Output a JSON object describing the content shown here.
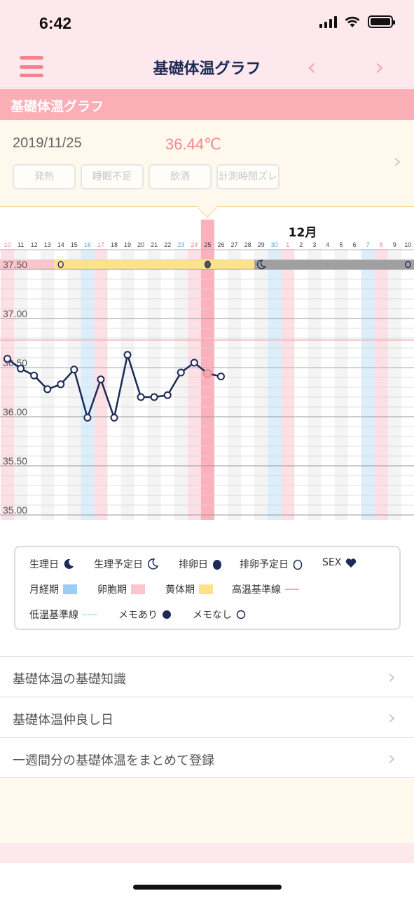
{
  "status_bar": {
    "time": "6:42"
  },
  "nav": {
    "title": "基礎体温グラフ",
    "prev": "‹",
    "next": "›"
  },
  "section": {
    "title": "基礎体温グラフ"
  },
  "day": {
    "date": "2019/11/25",
    "temperature": "36.44℃",
    "tags": [
      "発熱",
      "睡眠不足",
      "飲酒",
      "計測時間ズレ"
    ]
  },
  "chart_data": {
    "type": "line",
    "month_label": "12月",
    "x": [
      "10",
      "11",
      "12",
      "13",
      "14",
      "15",
      "16",
      "17",
      "18",
      "19",
      "20",
      "21",
      "22",
      "23",
      "24",
      "25",
      "26",
      "27",
      "28",
      "29",
      "30",
      "1",
      "2",
      "3",
      "4",
      "5",
      "6",
      "7",
      "8",
      "9",
      "10"
    ],
    "x_colors": {
      "saturday": [
        "16",
        "23",
        "30",
        "7"
      ],
      "sunday": [
        "10",
        "17",
        "24",
        "1",
        "8"
      ]
    },
    "ylim": [
      34.95,
      37.65
    ],
    "y_ticks": [
      35.0,
      35.5,
      36.0,
      36.5,
      37.0,
      37.5
    ],
    "y_tick_labels": [
      "35.00",
      "35.50",
      "36.00",
      "36.50",
      "37.00",
      "37.50"
    ],
    "series": [
      {
        "values": [
          36.59,
          36.49,
          36.42,
          36.28,
          36.33,
          36.48,
          35.99,
          36.38,
          35.99,
          36.63,
          36.2,
          36.2,
          36.22,
          36.45,
          36.55,
          36.44,
          36.41
        ]
      }
    ],
    "selected_day": "25",
    "high_baseline": 36.78,
    "low_baseline": 36.5,
    "phases": [
      {
        "phase": "follicular",
        "from": "10",
        "to": "13"
      },
      {
        "phase": "luteal",
        "from": "14",
        "to": "28"
      },
      {
        "phase": "predicted",
        "from": "29",
        "to": "10"
      }
    ],
    "phase_markers": [
      {
        "day": "14",
        "icon": "ovulation-predicted"
      },
      {
        "day": "25",
        "icon": "ovulation"
      },
      {
        "day": "29",
        "icon": "period-predicted"
      },
      {
        "day": "10",
        "icon": "ovulation-predicted"
      }
    ],
    "highlight_columns": {
      "menstrual": [
        "16",
        "30",
        "7"
      ],
      "fertile": [
        "10",
        "17",
        "24",
        "1",
        "8"
      ]
    }
  },
  "legend": {
    "items": [
      {
        "label": "生理日",
        "icon": "moon-filled-icon"
      },
      {
        "label": "生理予定日",
        "icon": "moon-outline-icon"
      },
      {
        "label": "排卵日",
        "icon": "egg-filled-icon"
      },
      {
        "label": "排卵予定日",
        "icon": "egg-outline-icon"
      },
      {
        "label": "SEX",
        "icon": "heart-icon"
      },
      {
        "label": "月経期",
        "icon": "menstrual-swatch"
      },
      {
        "label": "卵胞期",
        "icon": "follicular-swatch"
      },
      {
        "label": "黄体期",
        "icon": "luteal-swatch"
      },
      {
        "label": "高温基準線",
        "icon": "high-line"
      },
      {
        "label": "低温基準線",
        "icon": "low-line"
      },
      {
        "label": "メモあり",
        "icon": "memo-filled-icon"
      },
      {
        "label": "メモなし",
        "icon": "memo-empty-icon"
      }
    ]
  },
  "links": [
    {
      "label": "基礎体温の基礎知識"
    },
    {
      "label": "基礎体温仲良し日"
    },
    {
      "label": "一週間分の基礎体温をまとめて登録"
    }
  ],
  "colors": {
    "pink_bg": "#fde8ee",
    "section_pink": "#fbaeb6",
    "cream": "#fef8ed",
    "navy": "#1c2a55",
    "temp_pink": "#f4878f",
    "saturday_blue": "#5aa7e0",
    "sunday_pink": "#f3848f",
    "menstrual_blue": "#9ccdf2",
    "follicular_pink": "#fbc5cc",
    "luteal_yellow": "#fce38a",
    "predicted_gray": "#a0a0a0"
  }
}
